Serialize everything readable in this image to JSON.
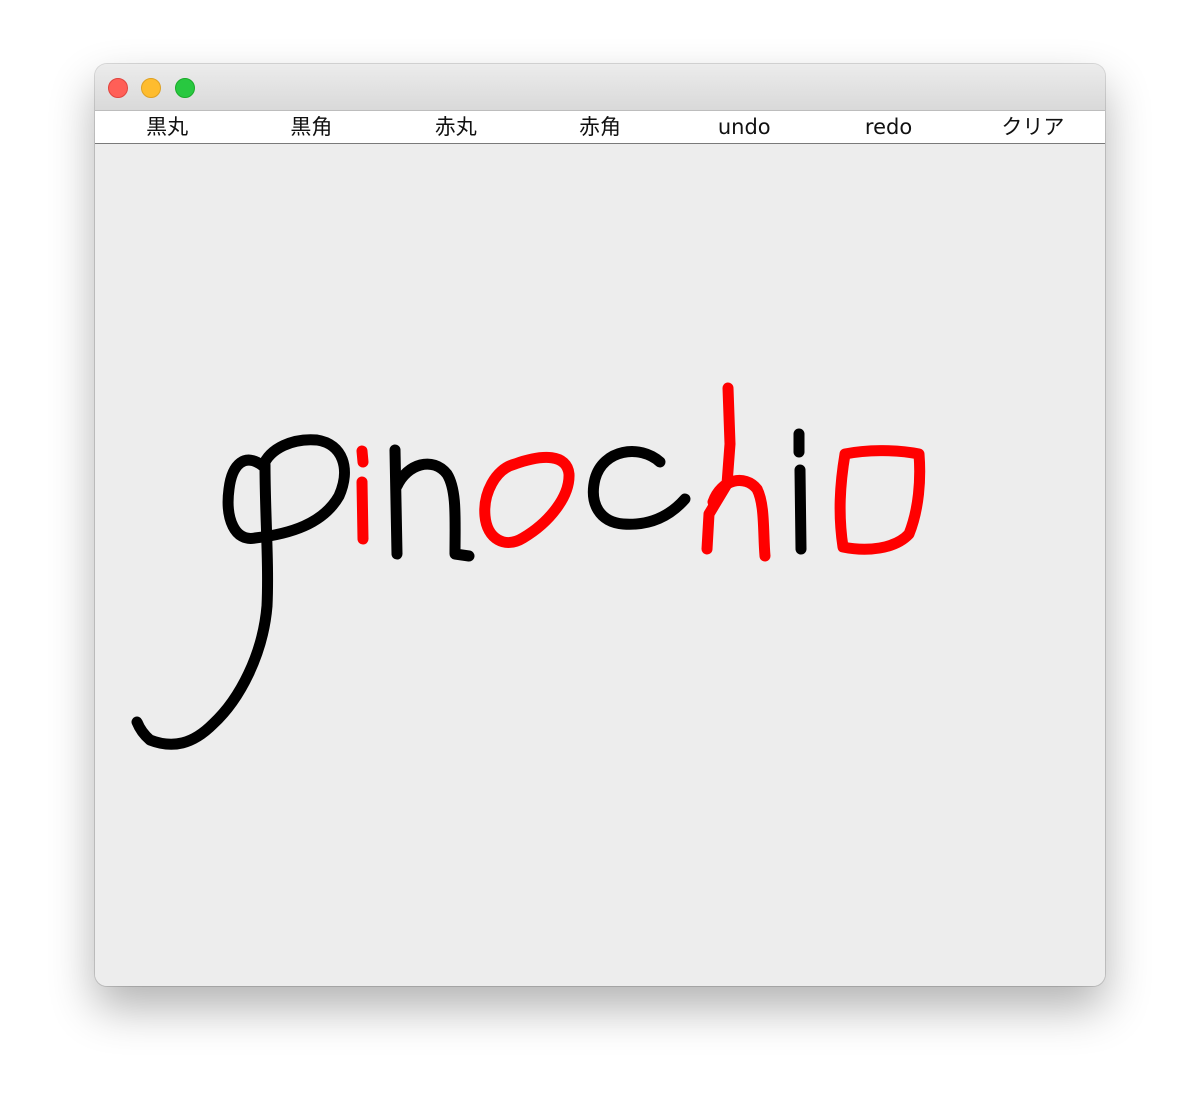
{
  "toolbar": {
    "buttons": [
      {
        "key": "black-circle",
        "label": "黒丸"
      },
      {
        "key": "black-square",
        "label": "黒角"
      },
      {
        "key": "red-circle",
        "label": "赤丸"
      },
      {
        "key": "red-square",
        "label": "赤角"
      },
      {
        "key": "undo",
        "label": "undo"
      },
      {
        "key": "redo",
        "label": "redo"
      },
      {
        "key": "clear",
        "label": "クリア"
      }
    ]
  },
  "drawing": {
    "colors": {
      "black": "#000000",
      "red": "#ff0000",
      "canvas_background": "#ededed"
    }
  }
}
